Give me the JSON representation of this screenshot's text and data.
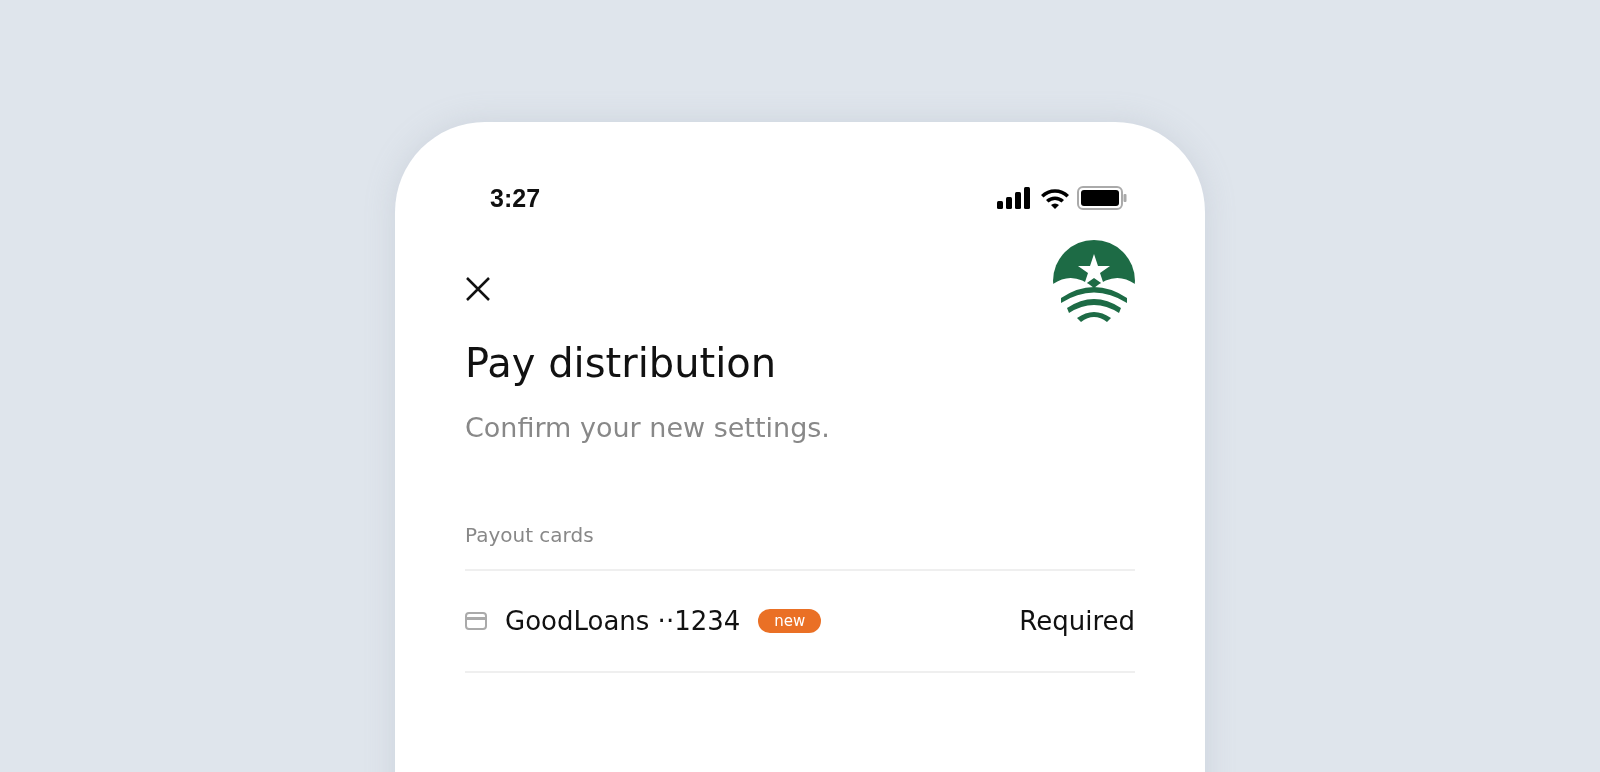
{
  "status_bar": {
    "time": "3:27"
  },
  "header": {
    "title": "Pay distribution",
    "subtitle": "Confirm your new settings."
  },
  "section": {
    "label": "Payout cards",
    "rows": [
      {
        "name": "GoodLoans ··1234",
        "badge": "new",
        "status": "Required"
      }
    ]
  }
}
